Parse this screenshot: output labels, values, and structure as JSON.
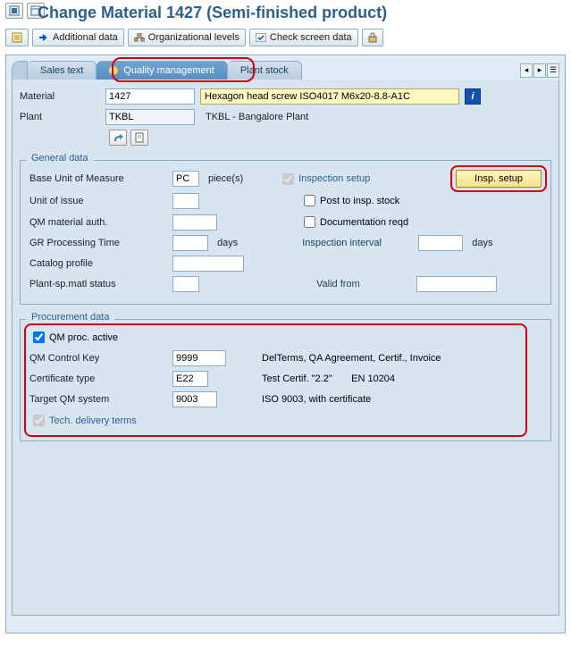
{
  "title": "Change Material 1427 (Semi-finished product)",
  "toolbar": {
    "additional_data": "Additional data",
    "org_levels": "Organizational levels",
    "check_screen": "Check screen data"
  },
  "tabs": {
    "sales": "Sales text",
    "qm": "Quality management",
    "plant_stock": "Plant stock"
  },
  "header": {
    "material_lbl": "Material",
    "material_val": "1427",
    "material_desc": "Hexagon head screw ISO4017 M6x20-8.8-A1C",
    "plant_lbl": "Plant",
    "plant_val": "TKBL",
    "plant_desc": "TKBL - Bangalore Plant"
  },
  "general": {
    "title": "General data",
    "buom_lbl": "Base Unit of Measure",
    "buom_val": "PC",
    "buom_desc": "piece(s)",
    "uoi_lbl": "Unit of issue",
    "qm_auth_lbl": "QM material auth.",
    "gr_lbl": "GR Processing Time",
    "gr_unit": "days",
    "catalog_lbl": "Catalog profile",
    "pmat_lbl": "Plant-sp.matl status",
    "insp_setup": "Inspection setup",
    "post_insp": "Post to insp. stock",
    "doc_reqd": "Documentation reqd",
    "insp_interval": "Inspection interval",
    "insp_interval_unit": "days",
    "valid_from": "Valid from",
    "insp_btn": "Insp. setup"
  },
  "procurement": {
    "title": "Procurement data",
    "qm_active": "QM proc. active",
    "ctrl_key_lbl": "QM Control Key",
    "ctrl_key_val": "9999",
    "ctrl_key_desc": "DelTerms, QA Agreement, Certif., Invoice",
    "cert_lbl": "Certificate type",
    "cert_val": "E22",
    "cert_desc": "Test Certif. \"2.2\"       EN 10204",
    "target_lbl": "Target QM system",
    "target_val": "9003",
    "target_desc": "ISO 9003, with certificate",
    "tech_terms": "Tech. delivery terms"
  }
}
